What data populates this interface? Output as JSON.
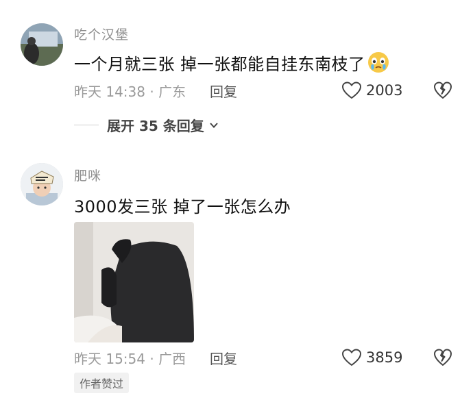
{
  "comments": [
    {
      "username": "吃个汉堡",
      "text": "一个月就三张 掉一张都能自挂东南枝了",
      "emoji": "crying-face-icon",
      "time_location": "昨天 14:38 · 广东",
      "reply_label": "回复",
      "likes": "2003",
      "expand_label": "展开 35 条回复"
    },
    {
      "username": "肥咪",
      "text": "3000发三张 掉了一张怎么办",
      "time_location": "昨天 15:54 · 广西",
      "reply_label": "回复",
      "likes": "3859",
      "badge": "作者赞过"
    }
  ],
  "colors": {
    "username": "#8f8f8f",
    "meta": "#9a9a9a",
    "text": "#111111"
  }
}
